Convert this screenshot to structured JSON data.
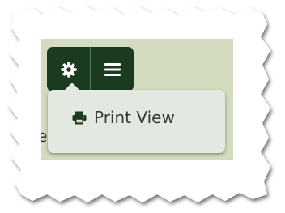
{
  "toolbar": {
    "buttons": [
      {
        "icon": "gear-icon"
      },
      {
        "icon": "hamburger-menu-icon"
      }
    ]
  },
  "background_text": "er",
  "dropdown": {
    "items": [
      {
        "icon": "printer-icon",
        "label": "Print View"
      }
    ]
  },
  "colors": {
    "toolbar_bg": "#1b3b20",
    "page_bg": "#d4dcc0",
    "dropdown_bg": "#e3e8e1",
    "text": "#2f3b34"
  }
}
